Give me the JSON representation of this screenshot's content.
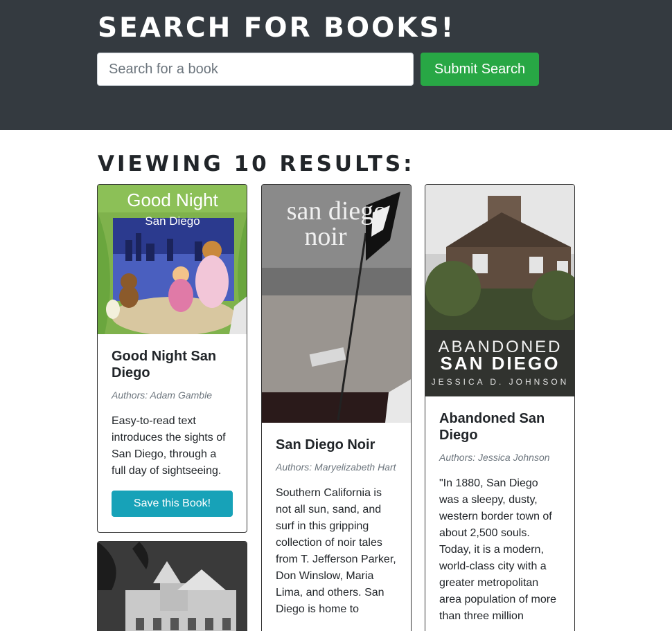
{
  "header": {
    "title": "SEARCH FOR BOOKS!",
    "search_placeholder": "Search for a book",
    "search_value": "",
    "submit_label": "Submit Search",
    "background_color": "#343a40",
    "submit_color": "#28a745"
  },
  "results": {
    "heading": "VIEWING 10 RESULTS:"
  },
  "books": [
    {
      "cover_title_line1": "Good Night",
      "cover_title_line2": "San Diego",
      "title": "Good Night San Diego",
      "authors": "Authors: Adam Gamble",
      "description": "Easy-to-read text introduces the sights of San Diego, through a full day of sightseeing.",
      "save_label": "Save this Book!"
    },
    {
      "cover_title_line1": "san diego",
      "cover_title_line2": "noir",
      "title": "San Diego Noir",
      "authors": "Authors: Maryelizabeth Hart",
      "description": "Southern California is not all sun, sand, and surf in this gripping collection of noir tales from T. Jefferson Parker, Don Winslow, Maria Lima, and others. San Diego is home to"
    },
    {
      "cover_title_line1": "ABANDONED",
      "cover_title_line2": "SAN DIEGO",
      "cover_author": "JESSICA D. JOHNSON",
      "title": "Abandoned San Diego",
      "authors": "Authors: Jessica Johnson",
      "description": "\"In 1880, San Diego was a sleepy, dusty, western border town of about 2,500 souls. Today, it is a modern, world-class city with a greater metropolitan area population of more than three million"
    },
    {
      "title": ""
    }
  ]
}
